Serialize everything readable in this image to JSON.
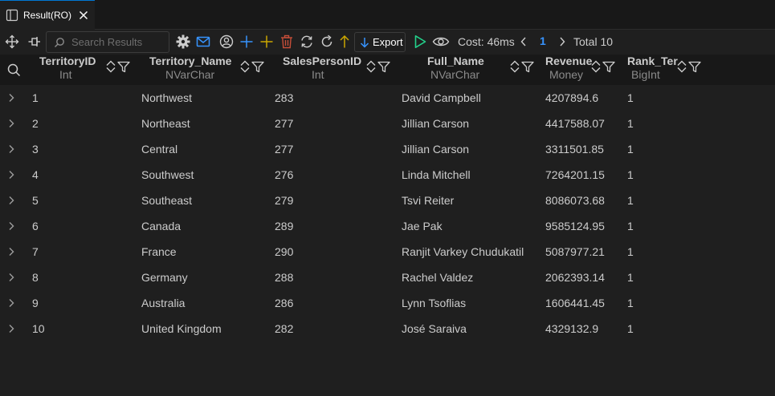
{
  "tab": {
    "label": "Result(RO)"
  },
  "toolbar": {
    "search_placeholder": "Search Results",
    "export_label": "Export",
    "cost_label": "Cost: 46ms",
    "page": "1",
    "total_label": "Total 10"
  },
  "columns": [
    {
      "name": "TerritoryID",
      "type": "Int"
    },
    {
      "name": "Territory_Name",
      "type": "NVarChar"
    },
    {
      "name": "SalesPersonID",
      "type": "Int"
    },
    {
      "name": "Full_Name",
      "type": "NVarChar"
    },
    {
      "name": "Revenue",
      "type": "Money"
    },
    {
      "name": "Rank_Ter",
      "type": "BigInt"
    }
  ],
  "rows": [
    [
      "1",
      "Northwest",
      "283",
      "David Campbell",
      "4207894.6",
      "1"
    ],
    [
      "2",
      "Northeast",
      "277",
      "Jillian Carson",
      "4417588.07",
      "1"
    ],
    [
      "3",
      "Central",
      "277",
      "Jillian Carson",
      "3311501.85",
      "1"
    ],
    [
      "4",
      "Southwest",
      "276",
      "Linda Mitchell",
      "7264201.15",
      "1"
    ],
    [
      "5",
      "Southeast",
      "279",
      "Tsvi Reiter",
      "8086073.68",
      "1"
    ],
    [
      "6",
      "Canada",
      "289",
      "Jae Pak",
      "9585124.95",
      "1"
    ],
    [
      "7",
      "France",
      "290",
      "Ranjit Varkey Chudukatil",
      "5087977.21",
      "1"
    ],
    [
      "8",
      "Germany",
      "288",
      "Rachel Valdez",
      "2062393.14",
      "1"
    ],
    [
      "9",
      "Australia",
      "286",
      "Lynn Tsoflias",
      "1606441.45",
      "1"
    ],
    [
      "10",
      "United Kingdom",
      "282",
      "José Saraiva",
      "4329132.9",
      "1"
    ]
  ],
  "colors": {
    "background": "#1f1f1f",
    "header_background": "#181818",
    "accent": "#0078d4",
    "page_number": "#3794ff",
    "run_green": "#23d18b",
    "add_blue": "#3794ff",
    "insert_gold": "#cca700",
    "delete_red": "#c74e39"
  }
}
